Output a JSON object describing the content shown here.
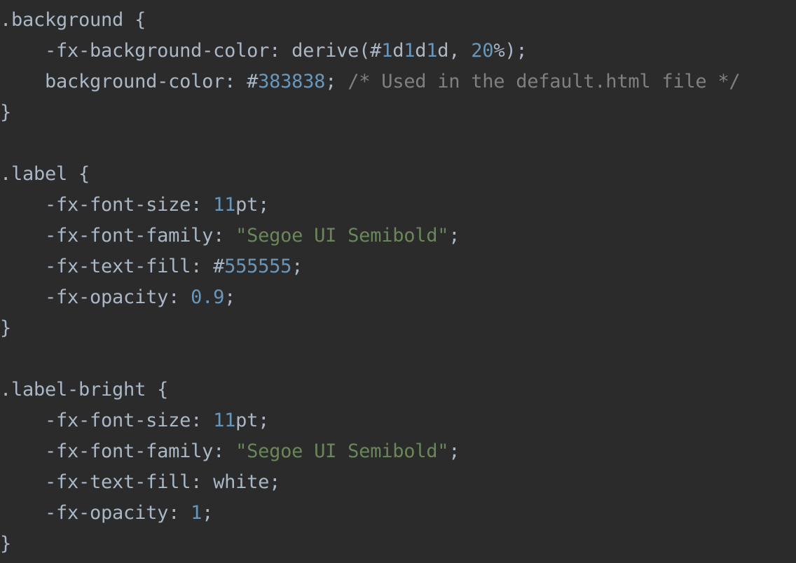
{
  "editor": {
    "language": "css",
    "theme": "darcula",
    "background_color": "#2b2b2b",
    "colors": {
      "plain": "#a9b7c6",
      "number": "#6897bb",
      "string": "#6a8759",
      "comment": "#808080"
    },
    "lines": [
      {
        "index": 1,
        "text": ".background {",
        "tokens": [
          {
            "text": ".background {",
            "kind": "plain"
          }
        ]
      },
      {
        "index": 2,
        "text": "    -fx-background-color: derive(#1d1d1d, 20%);",
        "tokens": [
          {
            "text": "    -fx-background-color: derive(#",
            "kind": "plain"
          },
          {
            "text": "1",
            "kind": "number"
          },
          {
            "text": "d",
            "kind": "plain"
          },
          {
            "text": "1",
            "kind": "number"
          },
          {
            "text": "d",
            "kind": "plain"
          },
          {
            "text": "1",
            "kind": "number"
          },
          {
            "text": "d, ",
            "kind": "plain"
          },
          {
            "text": "20",
            "kind": "number"
          },
          {
            "text": "%);",
            "kind": "plain"
          }
        ]
      },
      {
        "index": 3,
        "text": "    background-color: #383838; /* Used in the default.html file */",
        "tokens": [
          {
            "text": "    background-color: #",
            "kind": "plain"
          },
          {
            "text": "383838",
            "kind": "number"
          },
          {
            "text": "; ",
            "kind": "plain"
          },
          {
            "text": "/* Used in the default.html file */",
            "kind": "comment"
          }
        ]
      },
      {
        "index": 4,
        "text": "}",
        "tokens": [
          {
            "text": "}",
            "kind": "plain"
          }
        ]
      },
      {
        "index": 5,
        "text": "",
        "tokens": []
      },
      {
        "index": 6,
        "text": ".label {",
        "tokens": [
          {
            "text": ".label {",
            "kind": "plain"
          }
        ]
      },
      {
        "index": 7,
        "text": "    -fx-font-size: 11pt;",
        "tokens": [
          {
            "text": "    -fx-font-size: ",
            "kind": "plain"
          },
          {
            "text": "11",
            "kind": "number"
          },
          {
            "text": "pt;",
            "kind": "plain"
          }
        ]
      },
      {
        "index": 8,
        "text": "    -fx-font-family: \"Segoe UI Semibold\";",
        "tokens": [
          {
            "text": "    -fx-font-family: ",
            "kind": "plain"
          },
          {
            "text": "\"Segoe UI Semibold\"",
            "kind": "string"
          },
          {
            "text": ";",
            "kind": "plain"
          }
        ]
      },
      {
        "index": 9,
        "text": "    -fx-text-fill: #555555;",
        "tokens": [
          {
            "text": "    -fx-text-fill: #",
            "kind": "plain"
          },
          {
            "text": "555555",
            "kind": "number"
          },
          {
            "text": ";",
            "kind": "plain"
          }
        ]
      },
      {
        "index": 10,
        "text": "    -fx-opacity: 0.9;",
        "tokens": [
          {
            "text": "    -fx-opacity: ",
            "kind": "plain"
          },
          {
            "text": "0.9",
            "kind": "number"
          },
          {
            "text": ";",
            "kind": "plain"
          }
        ]
      },
      {
        "index": 11,
        "text": "}",
        "tokens": [
          {
            "text": "}",
            "kind": "plain"
          }
        ]
      },
      {
        "index": 12,
        "text": "",
        "tokens": []
      },
      {
        "index": 13,
        "text": ".label-bright {",
        "tokens": [
          {
            "text": ".label-bright {",
            "kind": "plain"
          }
        ]
      },
      {
        "index": 14,
        "text": "    -fx-font-size: 11pt;",
        "tokens": [
          {
            "text": "    -fx-font-size: ",
            "kind": "plain"
          },
          {
            "text": "11",
            "kind": "number"
          },
          {
            "text": "pt;",
            "kind": "plain"
          }
        ]
      },
      {
        "index": 15,
        "text": "    -fx-font-family: \"Segoe UI Semibold\";",
        "tokens": [
          {
            "text": "    -fx-font-family: ",
            "kind": "plain"
          },
          {
            "text": "\"Segoe UI Semibold\"",
            "kind": "string"
          },
          {
            "text": ";",
            "kind": "plain"
          }
        ]
      },
      {
        "index": 16,
        "text": "    -fx-text-fill: white;",
        "tokens": [
          {
            "text": "    -fx-text-fill: white;",
            "kind": "plain"
          }
        ]
      },
      {
        "index": 17,
        "text": "    -fx-opacity: 1;",
        "tokens": [
          {
            "text": "    -fx-opacity: ",
            "kind": "plain"
          },
          {
            "text": "1",
            "kind": "number"
          },
          {
            "text": ";",
            "kind": "plain"
          }
        ]
      },
      {
        "index": 18,
        "text": "}",
        "tokens": [
          {
            "text": "}",
            "kind": "plain"
          }
        ]
      }
    ]
  }
}
